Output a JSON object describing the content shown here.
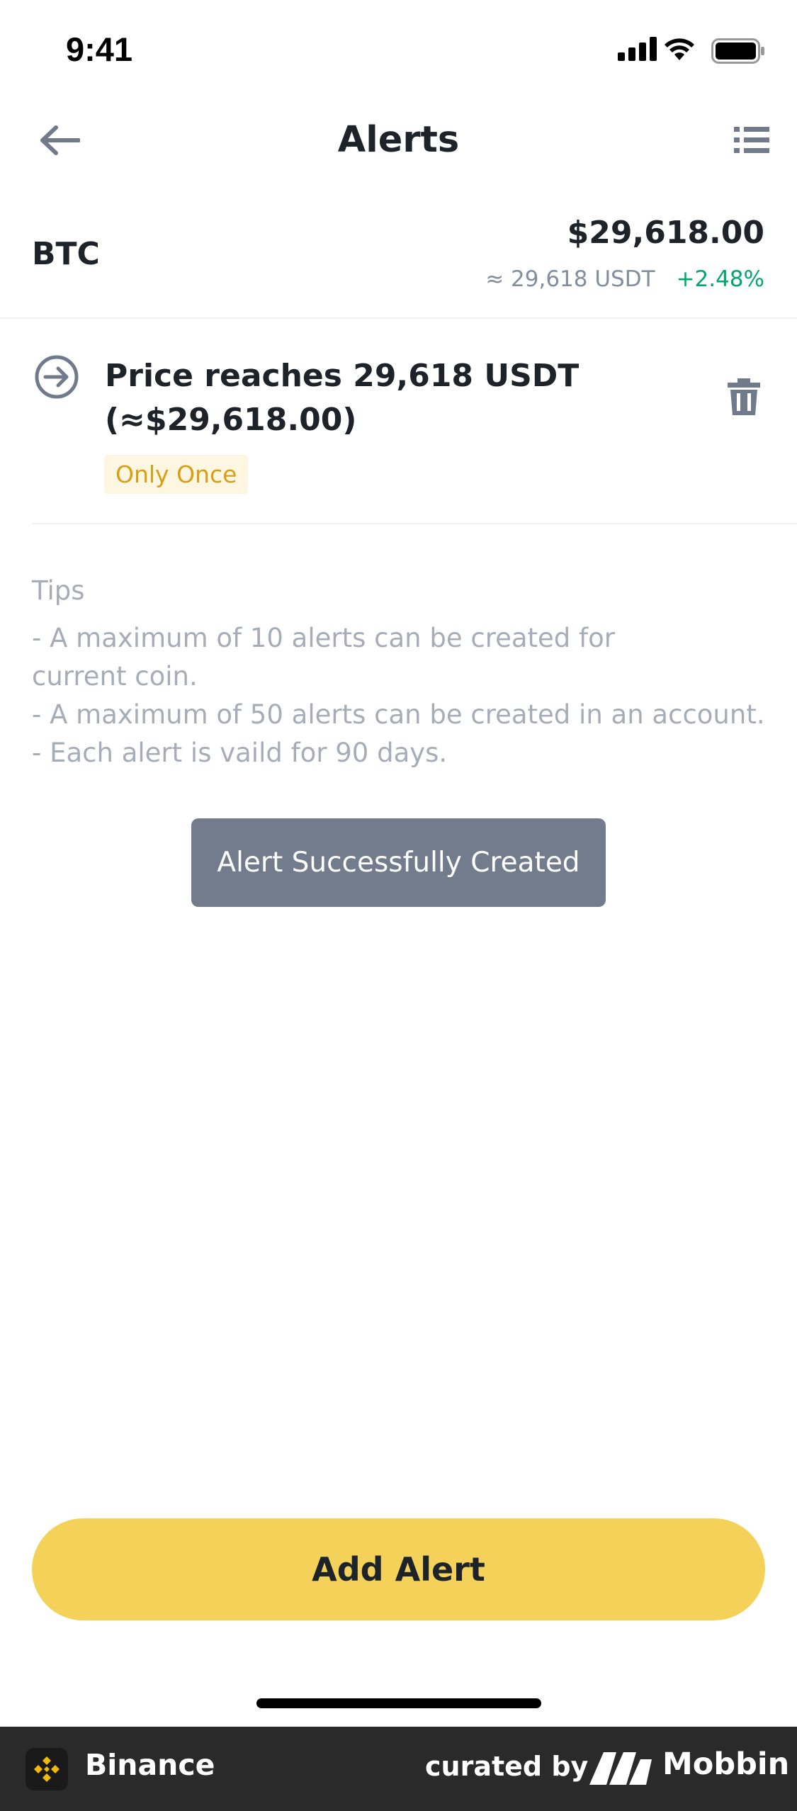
{
  "status_bar": {
    "time": "9:41"
  },
  "nav": {
    "title": "Alerts"
  },
  "ticker": {
    "symbol": "BTC",
    "price": "$29,618.00",
    "usdt": "≈ 29,618 USDT",
    "change": "+2.48%"
  },
  "alert": {
    "line1": "Price reaches 29,618 USDT",
    "line2": "(≈$29,618.00)",
    "frequency": "Only Once"
  },
  "tips": {
    "title": "Tips",
    "lines": [
      "- A maximum of 10 alerts can be created for",
      "current coin.",
      "- A maximum of 50 alerts can be created in an account.",
      "- Each alert is vaild for 90 days."
    ]
  },
  "toast": {
    "message": "Alert Successfully Created"
  },
  "actions": {
    "add_alert": "Add Alert"
  },
  "footer": {
    "app_name": "Binance",
    "curated_by": "curated by",
    "brand": "Mobbin"
  },
  "colors": {
    "accent_yellow": "#f4d25a",
    "positive_green": "#03a66d",
    "badge_bg": "#fdf6e1",
    "badge_text": "#d89f16",
    "toast_bg": "#737c8c"
  },
  "icons": [
    "signal-icon",
    "wifi-icon",
    "battery-icon",
    "back-arrow-icon",
    "list-icon",
    "arrow-right-circle-icon",
    "trash-icon",
    "binance-logo-icon",
    "mobbin-logo-icon"
  ]
}
